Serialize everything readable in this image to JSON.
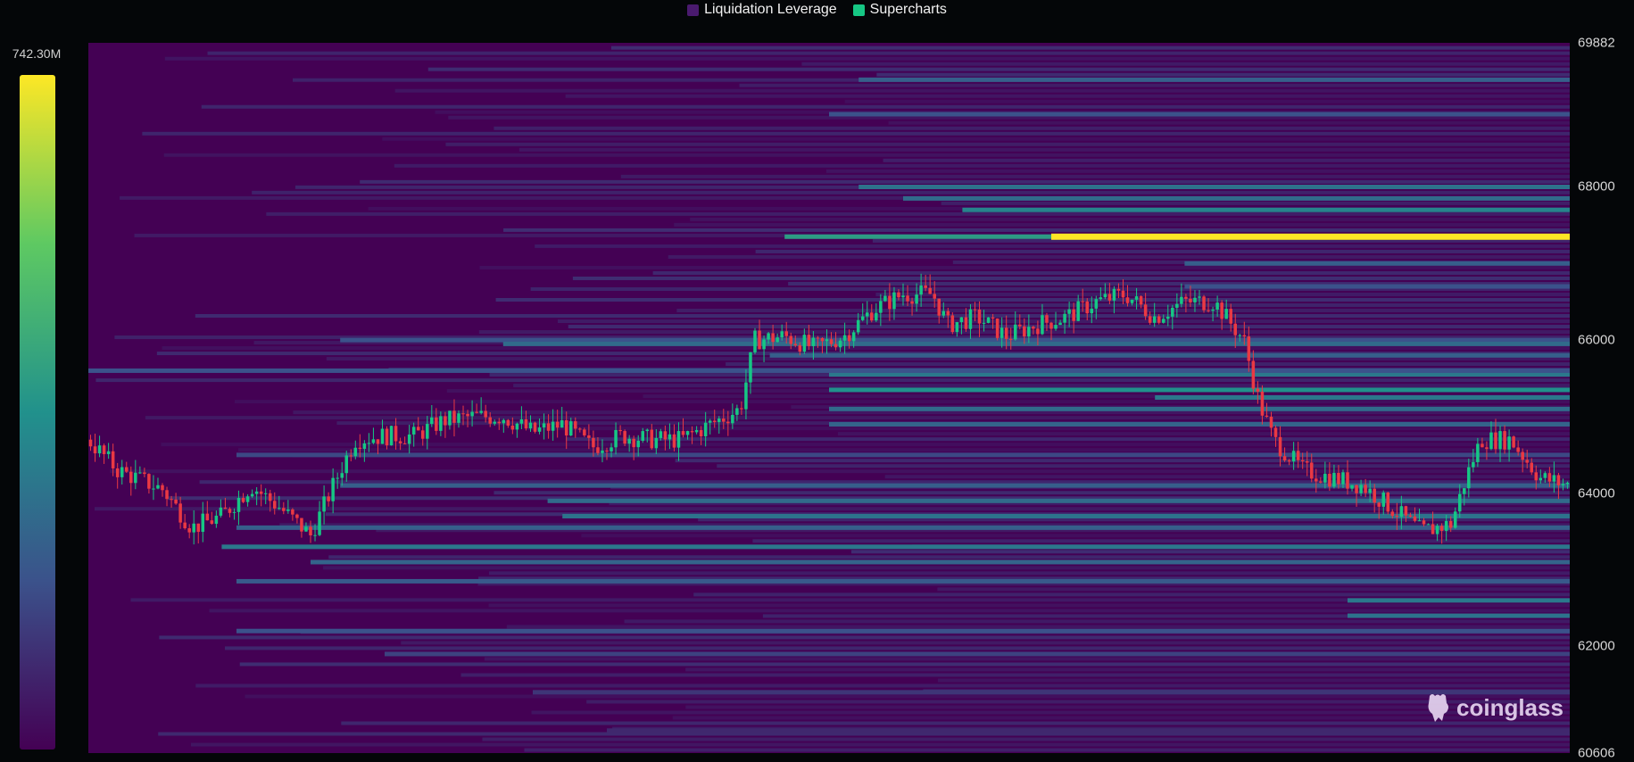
{
  "legend": [
    {
      "label": "Liquidation Leverage",
      "color": "#4a1a6e"
    },
    {
      "label": "Supercharts",
      "color": "#16c784"
    }
  ],
  "color_scale": {
    "max_label": "742.30M",
    "stops": [
      "#fde725",
      "#5ec962",
      "#21918c",
      "#3b528b",
      "#440154"
    ]
  },
  "watermark": {
    "text": "coinglass",
    "icon": "coinglass-logo-icon"
  },
  "chart_data": {
    "type": "heatmap",
    "title": "",
    "xlabel": "",
    "ylabel": "",
    "ylim": [
      60606,
      69882
    ],
    "y_ticks": [
      69882,
      68000,
      66000,
      64000,
      62000,
      60606
    ],
    "up_color": "#16c784",
    "down_color": "#ea3943",
    "heat_bands": [
      {
        "price": 67350,
        "from": 0.47,
        "intensity": 0.55
      },
      {
        "price": 67350,
        "from": 0.65,
        "intensity": 1.0
      },
      {
        "price": 67700,
        "from": 0.59,
        "intensity": 0.45
      },
      {
        "price": 67850,
        "from": 0.55,
        "intensity": 0.35
      },
      {
        "price": 68000,
        "from": 0.52,
        "intensity": 0.38
      },
      {
        "price": 68950,
        "from": 0.5,
        "intensity": 0.25
      },
      {
        "price": 69400,
        "from": 0.52,
        "intensity": 0.3
      },
      {
        "price": 67000,
        "from": 0.74,
        "intensity": 0.3
      },
      {
        "price": 66700,
        "from": 0.74,
        "intensity": 0.25
      },
      {
        "price": 66000,
        "from": 0.17,
        "intensity": 0.25
      },
      {
        "price": 65950,
        "from": 0.28,
        "intensity": 0.35
      },
      {
        "price": 65800,
        "from": 0.46,
        "intensity": 0.3
      },
      {
        "price": 65550,
        "from": 0.5,
        "intensity": 0.4
      },
      {
        "price": 65350,
        "from": 0.5,
        "intensity": 0.5
      },
      {
        "price": 65250,
        "from": 0.72,
        "intensity": 0.4
      },
      {
        "price": 65600,
        "from": 0.0,
        "intensity": 0.25
      },
      {
        "price": 65100,
        "from": 0.5,
        "intensity": 0.35
      },
      {
        "price": 64900,
        "from": 0.5,
        "intensity": 0.32
      },
      {
        "price": 64500,
        "from": 0.1,
        "intensity": 0.22
      },
      {
        "price": 64100,
        "from": 0.17,
        "intensity": 0.3
      },
      {
        "price": 63900,
        "from": 0.31,
        "intensity": 0.35
      },
      {
        "price": 63700,
        "from": 0.32,
        "intensity": 0.38
      },
      {
        "price": 63550,
        "from": 0.1,
        "intensity": 0.3
      },
      {
        "price": 63300,
        "from": 0.09,
        "intensity": 0.4
      },
      {
        "price": 63100,
        "from": 0.15,
        "intensity": 0.32
      },
      {
        "price": 62850,
        "from": 0.1,
        "intensity": 0.28
      },
      {
        "price": 62600,
        "from": 0.85,
        "intensity": 0.4
      },
      {
        "price": 62400,
        "from": 0.85,
        "intensity": 0.38
      },
      {
        "price": 62200,
        "from": 0.1,
        "intensity": 0.25
      },
      {
        "price": 61900,
        "from": 0.2,
        "intensity": 0.2
      },
      {
        "price": 61400,
        "from": 0.3,
        "intensity": 0.16
      },
      {
        "price": 60900,
        "from": 0.35,
        "intensity": 0.12
      }
    ],
    "price_path": [
      [
        0.0,
        64700
      ],
      [
        0.02,
        64300
      ],
      [
        0.05,
        64050
      ],
      [
        0.07,
        63550
      ],
      [
        0.09,
        63700
      ],
      [
        0.11,
        64100
      ],
      [
        0.13,
        63800
      ],
      [
        0.15,
        63450
      ],
      [
        0.17,
        64300
      ],
      [
        0.18,
        64700
      ],
      [
        0.2,
        64750
      ],
      [
        0.22,
        64750
      ],
      [
        0.24,
        64950
      ],
      [
        0.26,
        65000
      ],
      [
        0.28,
        65000
      ],
      [
        0.3,
        64800
      ],
      [
        0.32,
        64900
      ],
      [
        0.34,
        64600
      ],
      [
        0.36,
        64750
      ],
      [
        0.38,
        64700
      ],
      [
        0.4,
        64700
      ],
      [
        0.42,
        64900
      ],
      [
        0.44,
        65100
      ],
      [
        0.45,
        66000
      ],
      [
        0.47,
        66050
      ],
      [
        0.49,
        65900
      ],
      [
        0.51,
        66050
      ],
      [
        0.53,
        66400
      ],
      [
        0.55,
        66600
      ],
      [
        0.57,
        66600
      ],
      [
        0.58,
        66200
      ],
      [
        0.6,
        66300
      ],
      [
        0.62,
        66050
      ],
      [
        0.64,
        66200
      ],
      [
        0.66,
        66300
      ],
      [
        0.68,
        66500
      ],
      [
        0.7,
        66600
      ],
      [
        0.72,
        66300
      ],
      [
        0.74,
        66500
      ],
      [
        0.76,
        66500
      ],
      [
        0.78,
        66000
      ],
      [
        0.79,
        65200
      ],
      [
        0.8,
        64700
      ],
      [
        0.82,
        64300
      ],
      [
        0.84,
        64200
      ],
      [
        0.86,
        64100
      ],
      [
        0.88,
        63800
      ],
      [
        0.9,
        63500
      ],
      [
        0.92,
        63600
      ],
      [
        0.93,
        64200
      ],
      [
        0.94,
        64700
      ],
      [
        0.96,
        64700
      ],
      [
        0.98,
        64200
      ],
      [
        1.0,
        64100
      ]
    ]
  }
}
